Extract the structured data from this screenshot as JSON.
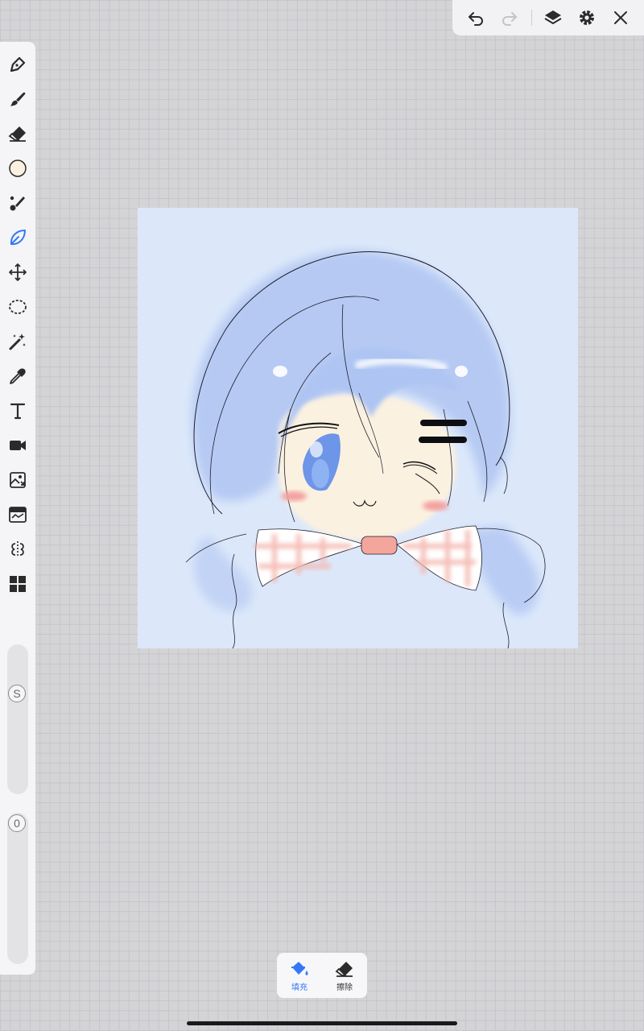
{
  "toolbar_top": {
    "icons": [
      "undo-icon",
      "redo-icon",
      "layers-icon",
      "settings-icon",
      "close-icon"
    ]
  },
  "tools": [
    "pen-icon",
    "brush-icon",
    "eraser-icon",
    "color-circle-icon",
    "smudge-icon",
    "leaf-brush-icon",
    "move-icon",
    "lasso-icon",
    "magic-wand-icon",
    "eyedropper-icon",
    "text-icon",
    "video-icon",
    "image-import-icon",
    "filter-icon",
    "symmetry-icon",
    "materials-icon"
  ],
  "colors": {
    "accent": "#3478f6",
    "canvas_bg": "#dce8fa",
    "hair": "#b5c9f3",
    "skin": "#fbf1e0",
    "blush": "#f2a0a0",
    "bow": "#f4b7b0"
  },
  "sliders": {
    "size_label": "S",
    "opacity_label": "0"
  },
  "bottom_popup": {
    "fill_label": "填充",
    "erase_label": "擦除"
  }
}
